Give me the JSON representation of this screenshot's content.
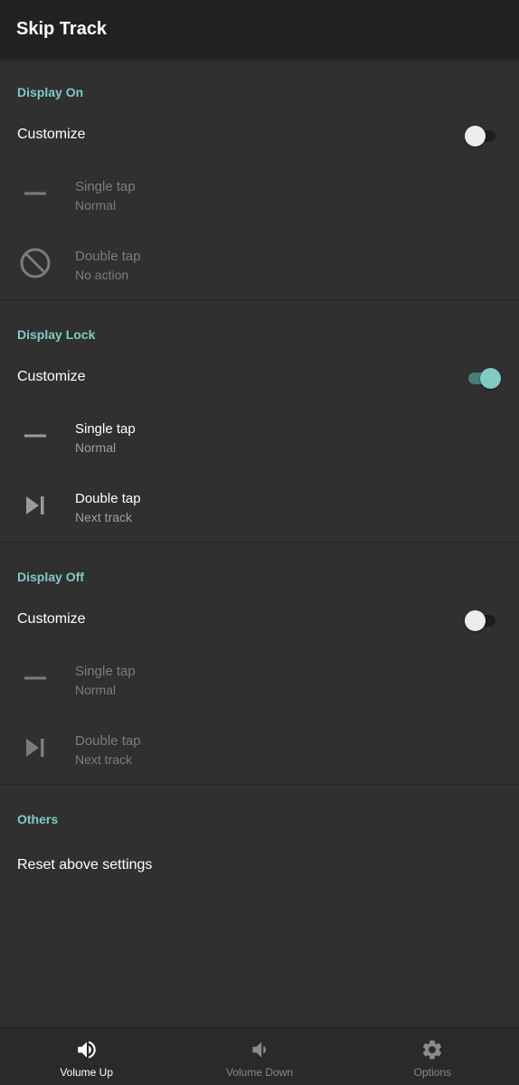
{
  "appbar": {
    "title": "Skip Track"
  },
  "sections": [
    {
      "header": "Display On",
      "customize_label": "Customize",
      "customize_on": false,
      "single": {
        "primary": "Single tap",
        "secondary": "Normal",
        "icon": "minus-icon"
      },
      "double": {
        "primary": "Double tap",
        "secondary": "No action",
        "icon": "block-icon"
      }
    },
    {
      "header": "Display Lock",
      "customize_label": "Customize",
      "customize_on": true,
      "single": {
        "primary": "Single tap",
        "secondary": "Normal",
        "icon": "minus-icon"
      },
      "double": {
        "primary": "Double tap",
        "secondary": "Next track",
        "icon": "skip-next-icon"
      }
    },
    {
      "header": "Display Off",
      "customize_label": "Customize",
      "customize_on": false,
      "single": {
        "primary": "Single tap",
        "secondary": "Normal",
        "icon": "minus-icon"
      },
      "double": {
        "primary": "Double tap",
        "secondary": "Next track",
        "icon": "skip-next-icon"
      }
    }
  ],
  "others": {
    "header": "Others",
    "reset_label": "Reset above settings"
  },
  "bottom_nav": [
    {
      "label": "Volume Up",
      "icon": "volume-up-icon",
      "active": true
    },
    {
      "label": "Volume Down",
      "icon": "volume-down-icon",
      "active": false
    },
    {
      "label": "Options",
      "icon": "gear-icon",
      "active": false
    }
  ],
  "colors": {
    "accent": "#80cbc4",
    "background": "#303030",
    "appbar": "#212121",
    "disabled_text": "#7c7c7c"
  }
}
